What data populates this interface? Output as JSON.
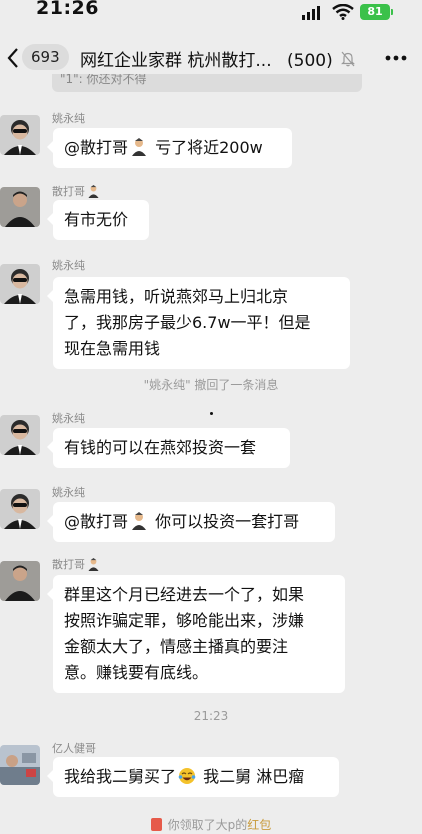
{
  "status": {
    "time": "21:26",
    "battery": "81"
  },
  "header": {
    "back_count": "693",
    "title": "网红企业家群 杭州散打...",
    "member_count": "(500)"
  },
  "prev_message_clip": "\"1\": 你还对不得",
  "messages": [
    {
      "sender": "姚永纯",
      "text_prefix": "@散打哥",
      "text_suffix": " 亏了将近200w"
    },
    {
      "sender": "散打哥",
      "text": "有市无价"
    },
    {
      "sender": "姚永纯",
      "lines": [
        "急需用钱，听说燕郊马上归北京",
        "了，我那房子最少6.7w一平！但是",
        "现在急需用钱"
      ]
    },
    {
      "sender": "姚永纯",
      "text": "有钱的可以在燕郊投资一套"
    },
    {
      "sender": "姚永纯",
      "text_prefix": "@散打哥",
      "text_suffix": " 你可以投资一套打哥"
    },
    {
      "sender": "散打哥",
      "lines": [
        "群里这个月已经进去一个了，如果",
        "按照诈骗定罪，够呛能出来，涉嫌",
        "金额太大了，情感主播真的要注",
        "意。赚钱要有底线。"
      ]
    },
    {
      "sender": "亿人健哥",
      "text_prefix": "我给我二舅买了",
      "text_suffix": " 我二舅 淋巴瘤"
    }
  ],
  "system": {
    "recall": "\"姚永纯\" 撤回了一条消息",
    "time_divider": "21:23",
    "redpacket_prefix": "你领取了大p的",
    "redpacket_link": "红包"
  },
  "colors": {
    "background": "#ededed",
    "bubble": "#ffffff",
    "battery": "#3bc14a",
    "redpacket_link": "#c89b3c"
  }
}
